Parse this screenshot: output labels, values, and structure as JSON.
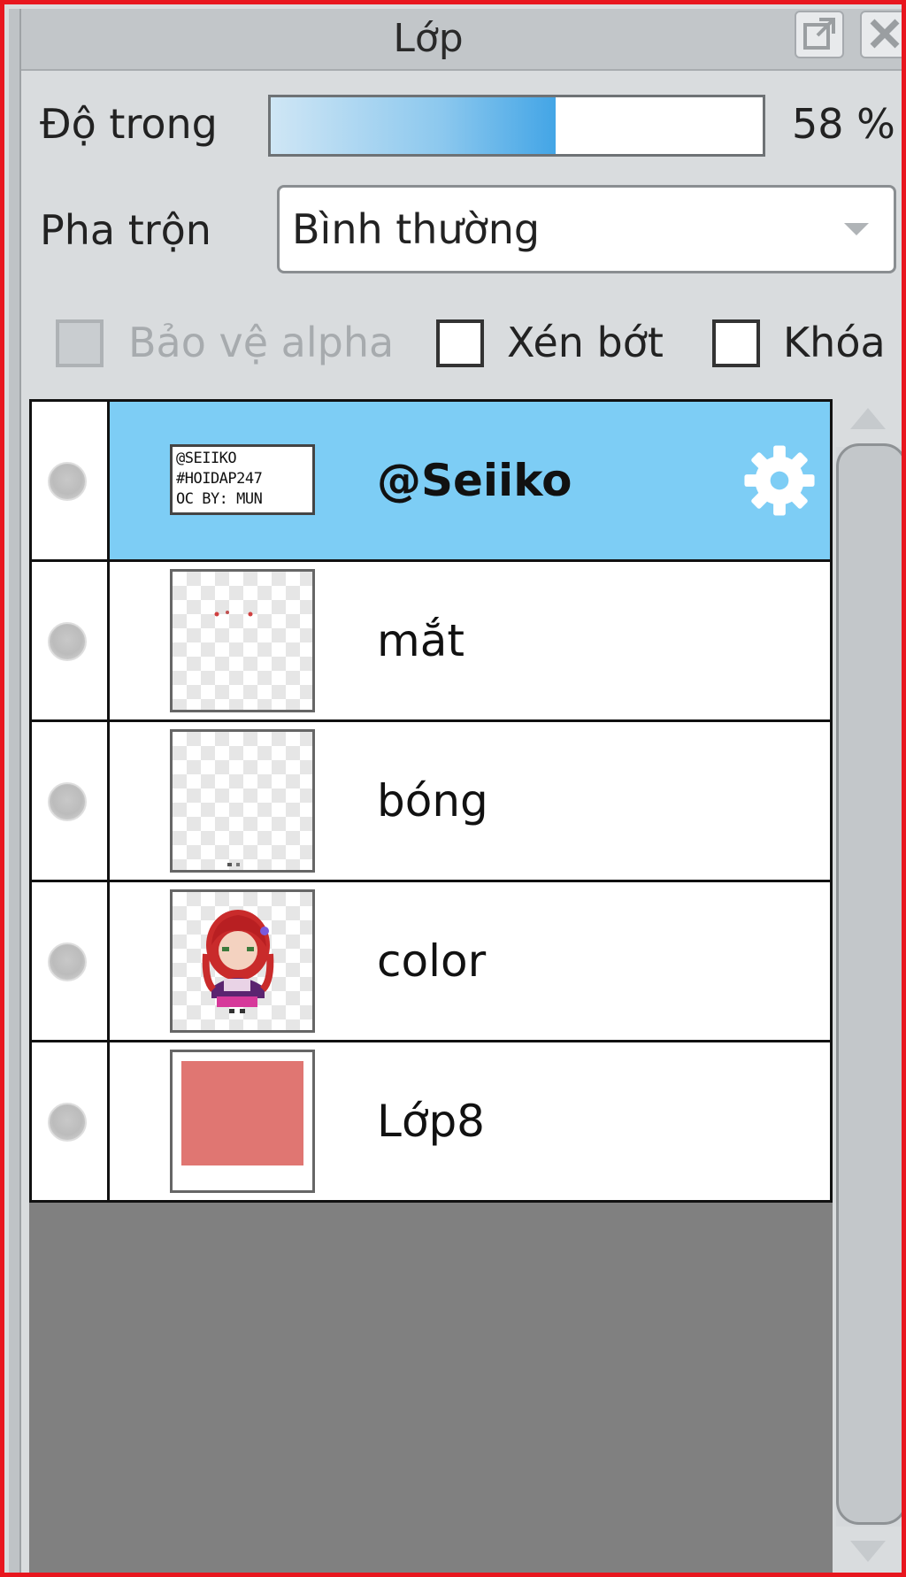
{
  "panel": {
    "title": "Lớp",
    "float_icon": "float-window-icon",
    "close_icon": "close-icon"
  },
  "opacity": {
    "label": "Độ trong",
    "value": 58,
    "value_text": "58 %"
  },
  "blend": {
    "label": "Pha trộn",
    "selected": "Bình thường"
  },
  "checkboxes": {
    "protect_alpha": {
      "label": "Bảo vệ alpha",
      "checked": false,
      "enabled": false
    },
    "clipping": {
      "label": "Xén bớt",
      "checked": false,
      "enabled": true
    },
    "lock": {
      "label": "Khóa",
      "checked": false,
      "enabled": true
    }
  },
  "layers": [
    {
      "name": "@Seiiko",
      "selected": true,
      "thumb": "text",
      "thumb_text": "@SEIIKO\n#HOIDAP247\nOC BY: MUN",
      "icon": "gear-icon"
    },
    {
      "name": "mắt",
      "selected": false,
      "thumb": "transparent-eyes"
    },
    {
      "name": "bóng",
      "selected": false,
      "thumb": "transparent-empty"
    },
    {
      "name": "color",
      "selected": false,
      "thumb": "character"
    },
    {
      "name": "Lớp8",
      "selected": false,
      "thumb": "solid-fill",
      "fill_color": "#e07672"
    }
  ],
  "colors": {
    "frame_border": "#e8161e",
    "selected_row": "#7dcdf5",
    "opacity_fill": "#43a5e6",
    "empty_area": "#808080"
  }
}
